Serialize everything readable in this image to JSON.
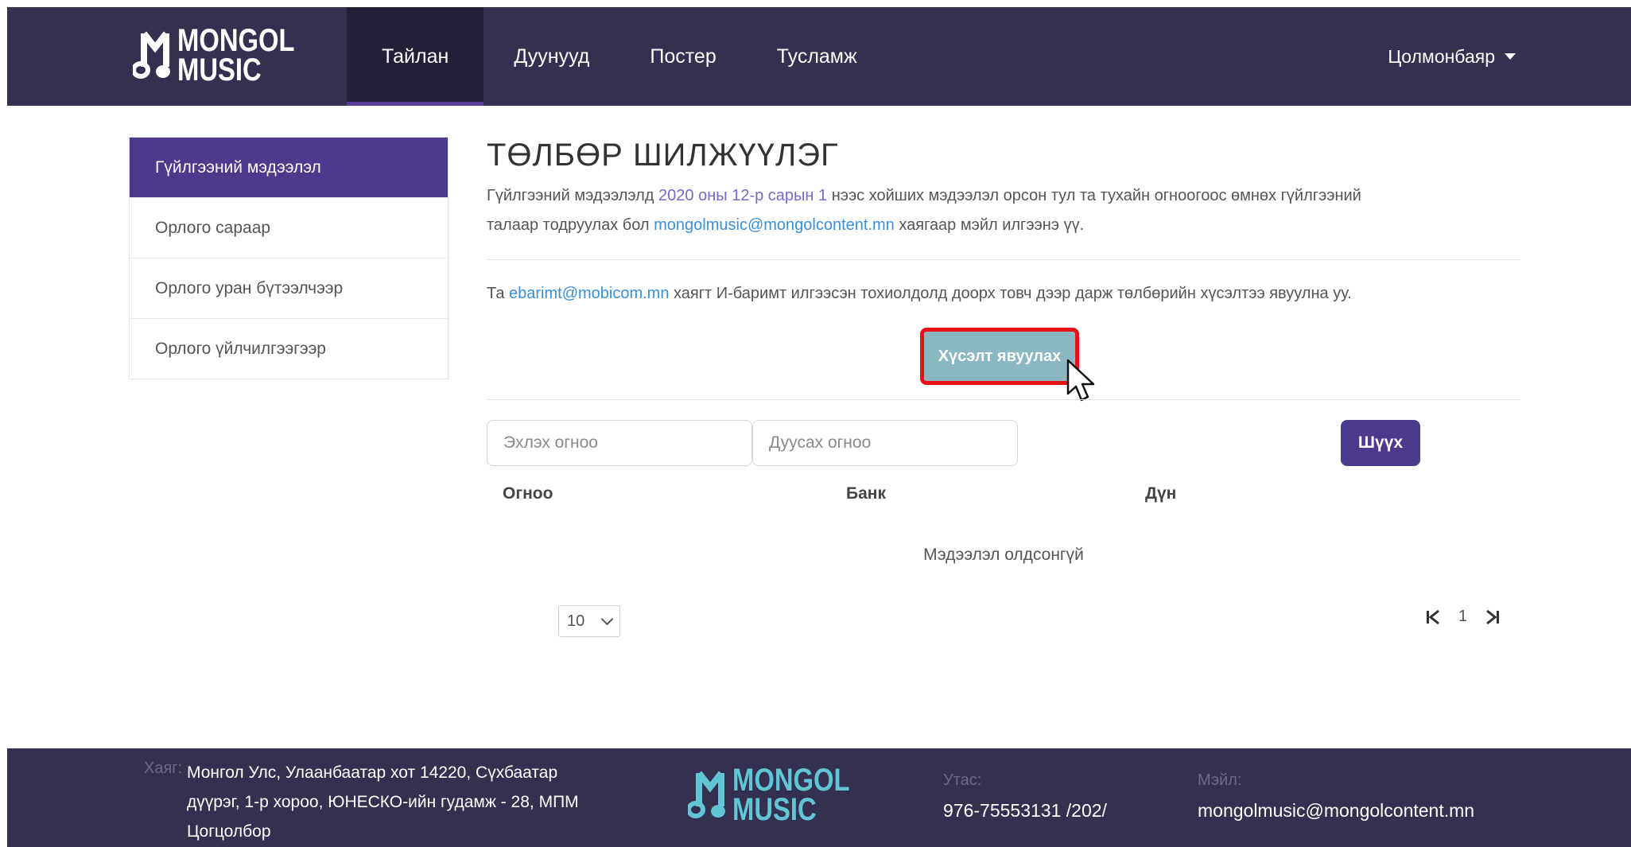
{
  "brand": {
    "line1": "MONGOL",
    "line2": "MUSIC",
    "header_color": "#34304f",
    "accent": "#4e3a8c",
    "footer_logo_color": "#62c5d6"
  },
  "nav": {
    "items": [
      {
        "label": "Тайлан",
        "active": true
      },
      {
        "label": "Дуунууд",
        "active": false
      },
      {
        "label": "Постер",
        "active": false
      },
      {
        "label": "Тусламж",
        "active": false
      }
    ],
    "user_name": "Цолмонбаяр"
  },
  "sidebar": {
    "items": [
      {
        "label": "Гүйлгээний мэдээлэл",
        "active": true
      },
      {
        "label": "Орлого сараар",
        "active": false
      },
      {
        "label": "Орлого уран бүтээлчээр",
        "active": false
      },
      {
        "label": "Орлого үйлчилгээгээр",
        "active": false
      }
    ]
  },
  "main": {
    "title": "ТӨЛБӨР ШИЛЖҮҮЛЭГ",
    "info": {
      "p1": "Гүйлгээний мэдээлэлд ",
      "date_hl": "2020 оны 12-р сарын 1",
      "p2": " нээс хойших мэдээлэл орсон тул та тухайн огноогоос өмнөх гүйлгээний",
      "p3": "талаар тодруулах бол ",
      "email": "mongolmusic@mongolcontent.mn",
      "p4": " хаягаар мэйл илгээнэ үү."
    },
    "ebarimt": {
      "p1": "Та ",
      "email": "ebarimt@mobicom.mn",
      "p2": " хаягт И-баримт илгээсэн тохиолдолд доорх товч дээр дарж төлбөрийн хүсэлтээ явуулна уу."
    },
    "request_button": "Хүсэлт явуулах",
    "start_date_placeholder": "Эхлэх огноо",
    "end_date_placeholder": "Дуусах огноо",
    "filter_button": "Шүүх",
    "table": {
      "columns": [
        "Огноо",
        "Банк",
        "Дүн"
      ],
      "empty_text": "Мэдээлэл олдсонгүй"
    },
    "page_size": "10",
    "current_page": "1"
  },
  "footer": {
    "address_label": "Хаяг:",
    "address": "Монгол Улс, Улаанбаатар хот 14220, Сүхбаатар дүүрэг, 1-р хороо, ЮНЕСКО-ийн гудамж - 28, МПМ Цогцолбор",
    "phone_label": "Утас:",
    "phone": "976-75553131 /202/",
    "mail_label": "Мэйл:",
    "mail": "mongolmusic@mongolcontent.mn"
  }
}
